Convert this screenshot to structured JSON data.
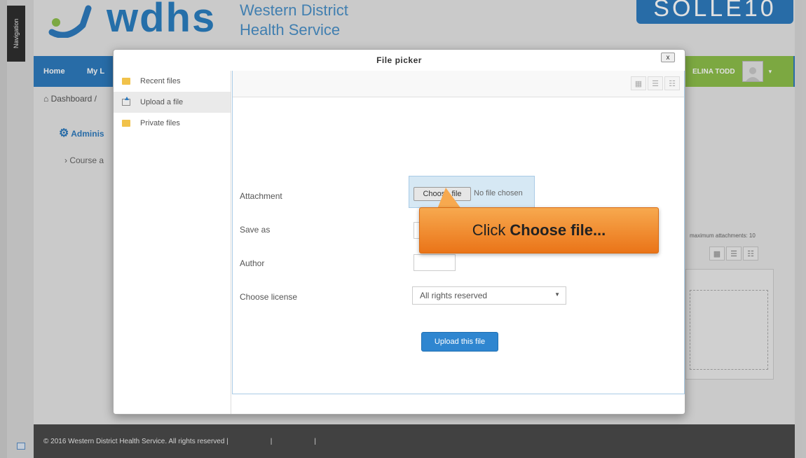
{
  "sidebar_tab": {
    "label": "Navigation"
  },
  "header": {
    "logo_wordmark": "wdhs",
    "org_line1": "Western District",
    "org_line2": "Health Service",
    "badge_text": "SOLLE10"
  },
  "nav": {
    "home": "Home",
    "my": "My L",
    "user_name": "ELINA TODD",
    "chevron": "▾"
  },
  "page": {
    "breadcrumb": "Dashboard /",
    "admin_title": "Adminis",
    "course_link": "Course a",
    "max_attachments": "maximum attachments: 10"
  },
  "file_picker": {
    "title": "File picker",
    "close": "x",
    "repositories": [
      {
        "label": "Recent files",
        "icon": "folder-icon"
      },
      {
        "label": "Upload a file",
        "icon": "upload-icon",
        "active": true
      },
      {
        "label": "Private files",
        "icon": "folder-icon"
      }
    ],
    "form": {
      "attachment_label": "Attachment",
      "choose_file_button": "Choose file",
      "no_file_text": "No file chosen",
      "save_as_label": "Save as",
      "save_as_value": "",
      "author_label": "Author",
      "author_value": "",
      "license_label": "Choose license",
      "license_value": "All rights reserved",
      "upload_button": "Upload this file"
    }
  },
  "callout": {
    "prefix": "Click",
    "bold": "Choose file..."
  },
  "footer": {
    "copyright": "© 2016 Western District Health Service. All rights reserved |",
    "sep": "|"
  },
  "colors": {
    "brand_blue": "#2e7bbf",
    "user_green": "#8ec04a",
    "callout_orange": "#ea7418"
  }
}
